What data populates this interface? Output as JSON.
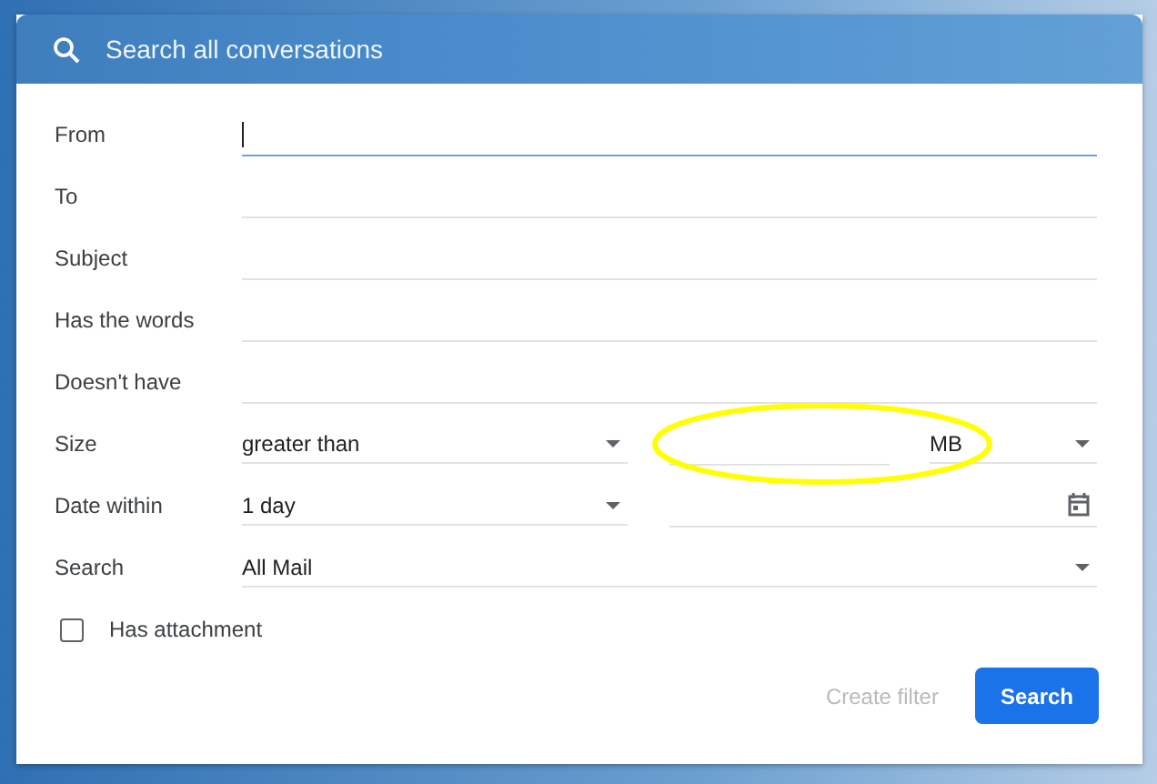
{
  "search_bar": {
    "placeholder": "Search all conversations"
  },
  "fields": [
    {
      "kind": "text",
      "label": "From",
      "focused": true
    },
    {
      "kind": "text",
      "label": "To",
      "focused": false
    },
    {
      "kind": "text",
      "label": "Subject",
      "focused": false
    },
    {
      "kind": "text",
      "label": "Has the words",
      "focused": false
    },
    {
      "kind": "text",
      "label": "Doesn't have",
      "focused": false
    },
    {
      "kind": "size",
      "label": "Size",
      "operator": "greater than",
      "unit": "MB"
    },
    {
      "kind": "date",
      "label": "Date within",
      "range": "1 day"
    },
    {
      "kind": "select",
      "label": "Search",
      "value": "All Mail"
    }
  ],
  "has_attachment": {
    "label": "Has attachment",
    "checked": false
  },
  "buttons": [
    {
      "label": "Create filter",
      "disabled": true
    },
    {
      "label": "Search",
      "disabled": false
    }
  ]
}
